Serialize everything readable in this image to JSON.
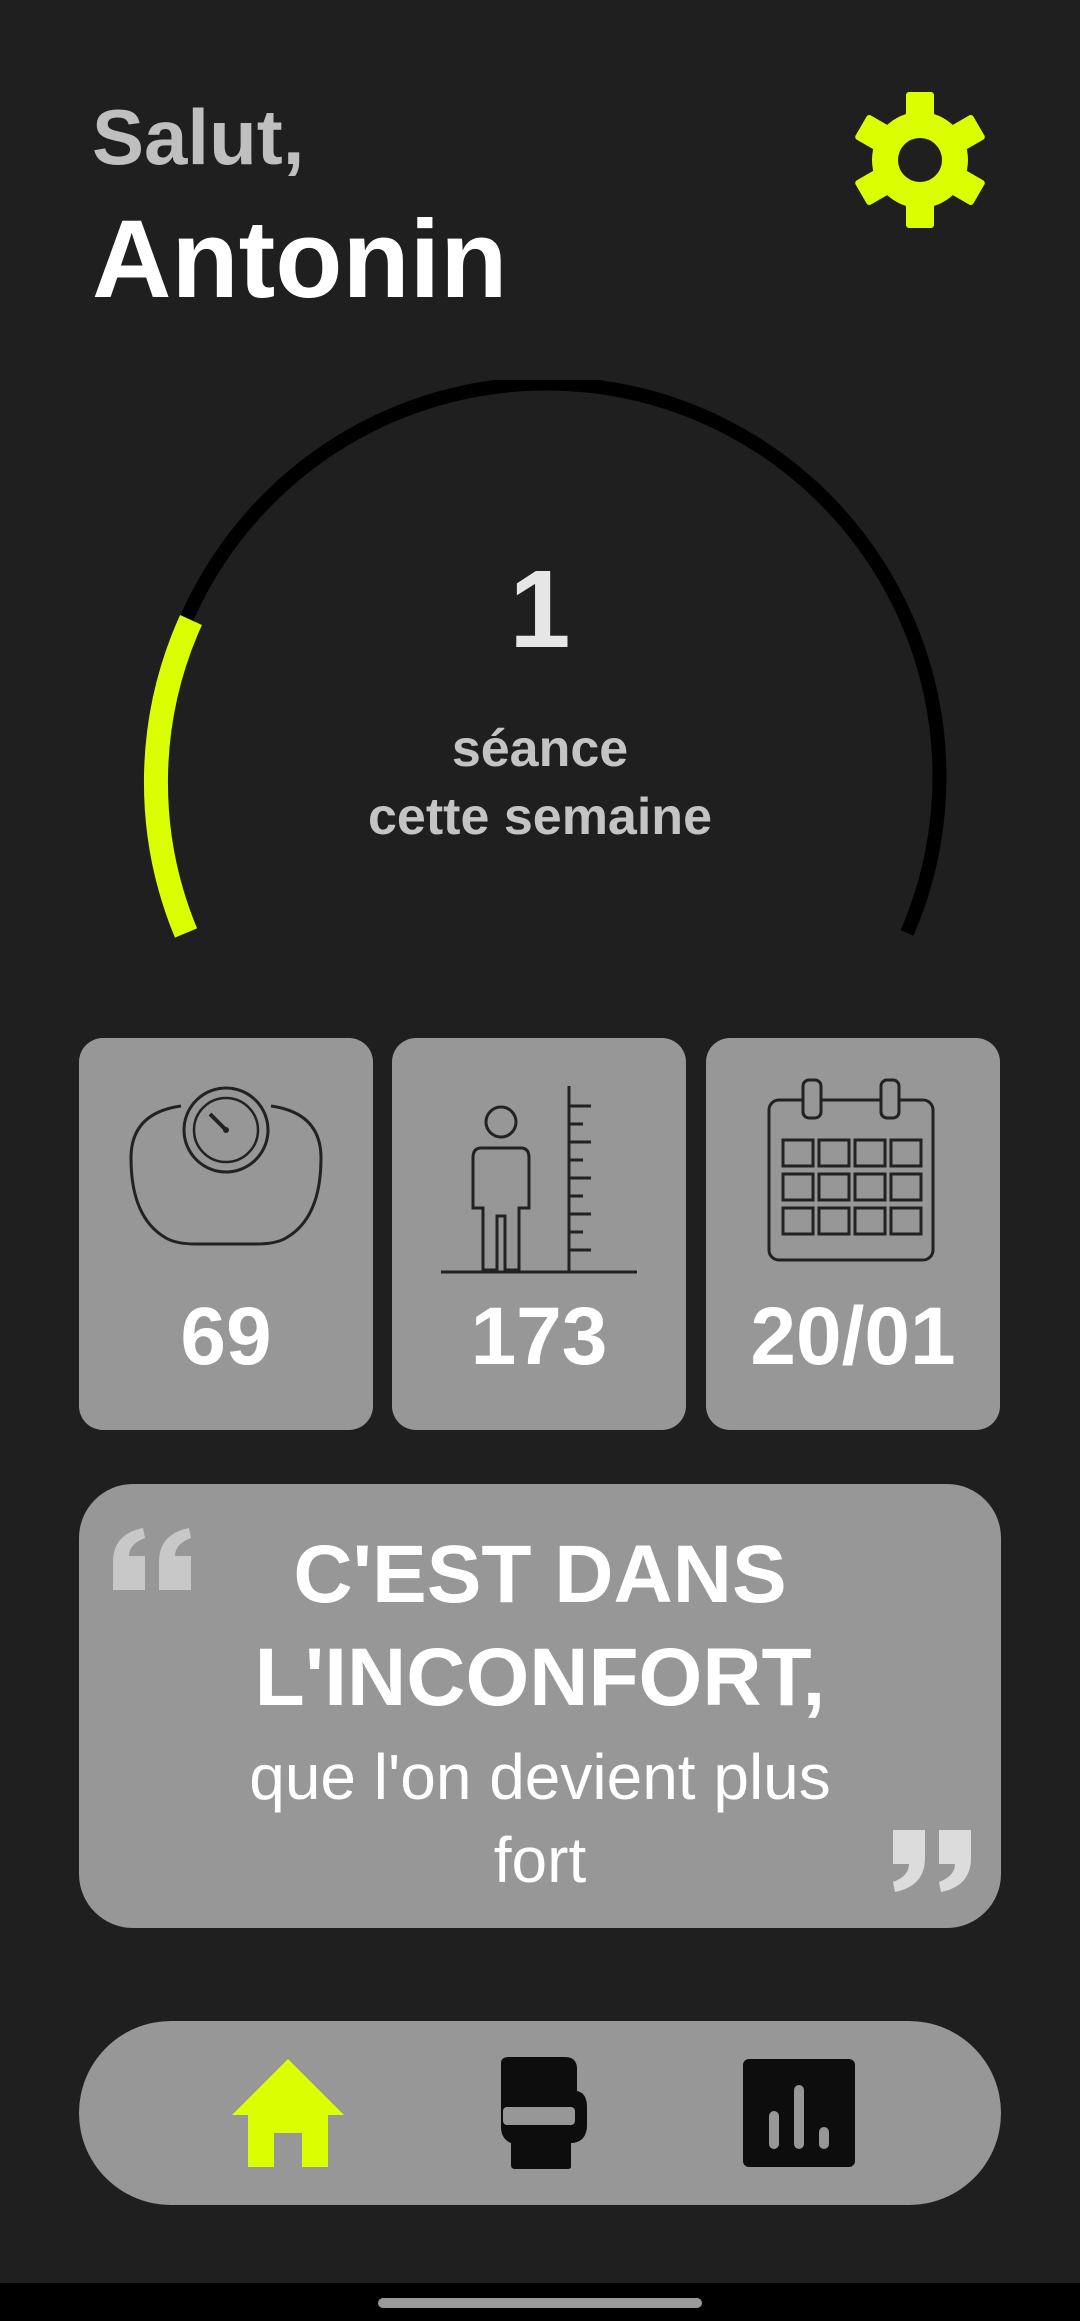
{
  "header": {
    "greeting": "Salut,",
    "name": "Antonin"
  },
  "progress": {
    "count": "1",
    "line1": "séance",
    "line2": "cette semaine",
    "fraction_filled": 0.13
  },
  "stats": [
    {
      "icon": "scale-icon",
      "value": "69"
    },
    {
      "icon": "height-ruler-icon",
      "value": "173"
    },
    {
      "icon": "calendar-icon",
      "value": "20/01"
    }
  ],
  "quote": {
    "line1": "C'EST DANS",
    "line2": "L'INCONFORT,",
    "rest": "que l'on devient plus fort"
  },
  "nav": [
    {
      "icon": "home-icon",
      "active": true
    },
    {
      "icon": "boxing-glove-icon",
      "active": false
    },
    {
      "icon": "stats-icon",
      "active": false
    }
  ],
  "colors": {
    "accent": "#d9ff00",
    "background": "#1f1f1f",
    "card": "#979797"
  }
}
